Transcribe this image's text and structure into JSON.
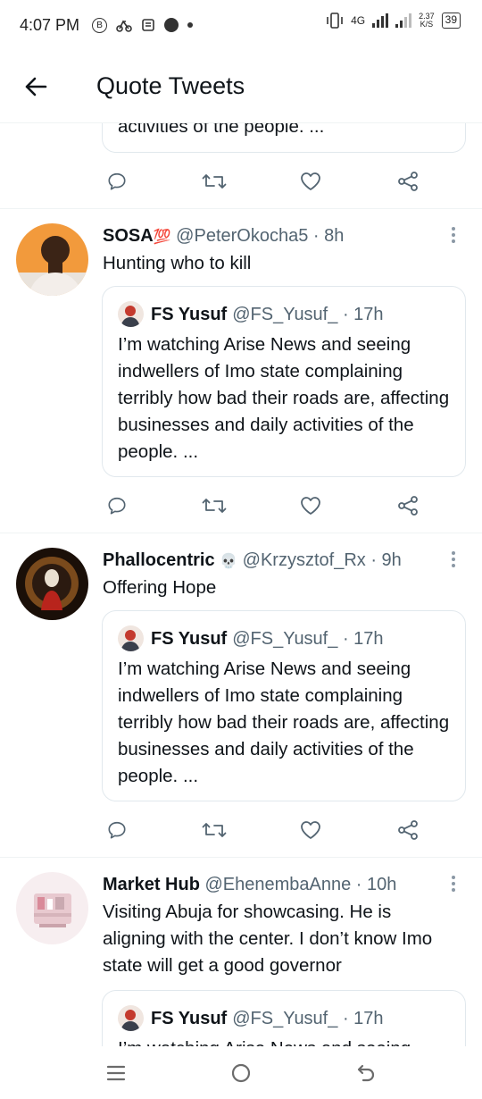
{
  "status_bar": {
    "time": "4:07 PM",
    "network": "4G",
    "speed_value": "2.37",
    "speed_unit": "K/S",
    "battery": "39",
    "left_icons": [
      "badge-icon",
      "bike-icon",
      "notes-icon",
      "messenger-icon",
      "dot-icon"
    ]
  },
  "header": {
    "title": "Quote Tweets"
  },
  "partial_quote": {
    "text": "activities of the people. ..."
  },
  "tweets": [
    {
      "display_name": "SOSA",
      "name_emoji": "💯",
      "handle": "@PeterOkocha5",
      "time": "· 8h",
      "text": "Hunting who to kill",
      "quote": {
        "display_name": "FS Yusuf",
        "handle": "@FS_Yusuf_",
        "time": "· 17h",
        "text": "I’m watching Arise News and seeing indwellers of Imo state complaining terribly how bad their roads are, affecting businesses and daily activities of the people. ..."
      }
    },
    {
      "display_name": "Phallocentric",
      "name_emoji": "💀",
      "handle": "@Krzysztof_Rx",
      "time": "· 9h",
      "text": "Offering Hope",
      "quote": {
        "display_name": "FS Yusuf",
        "handle": "@FS_Yusuf_",
        "time": "· 17h",
        "text": "I’m watching Arise News and seeing indwellers of Imo state complaining terribly how bad their roads are, affecting businesses and daily activities of the people. ..."
      }
    },
    {
      "display_name": "Market Hub",
      "name_emoji": "",
      "handle": "@EhenembaAnne",
      "time": "· 10h",
      "text": "Visiting Abuja for showcasing. He is aligning with the center. I don’t know Imo state will get a good governor",
      "quote": {
        "display_name": "FS Yusuf",
        "handle": "@FS_Yusuf_",
        "time": "· 17h",
        "text": "I’m watching Arise News and seeing"
      }
    }
  ],
  "actions": [
    "reply-icon",
    "retweet-icon",
    "like-icon",
    "share-icon"
  ],
  "nav": [
    "recent-apps-icon",
    "home-icon",
    "back-icon"
  ],
  "colors": {
    "text": "#0f1419",
    "muted": "#536471",
    "border": "#e1e8ed",
    "divider": "#eff3f4"
  }
}
